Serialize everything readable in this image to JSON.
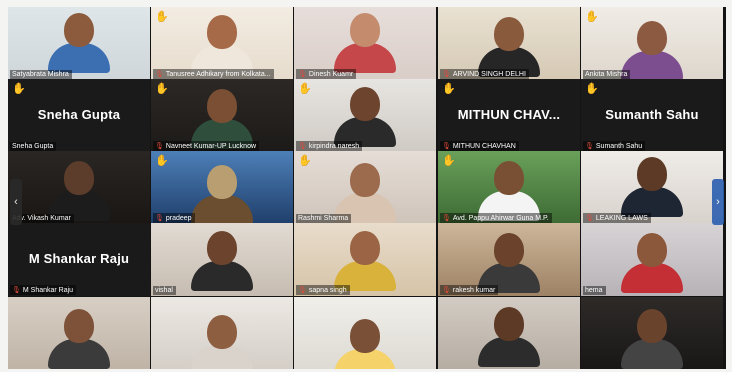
{
  "meeting": {
    "mic_glyph": "🎙",
    "hand_glyph": "✋",
    "tiles": [
      {
        "caption": "Satyabrata Mishra",
        "big_name": "",
        "hand": false,
        "mic_muted": false,
        "video": "man-blue"
      },
      {
        "caption": "Tanusree Adhikary from Kolkata...",
        "big_name": "",
        "hand": true,
        "mic_muted": true,
        "video": "woman-cream"
      },
      {
        "caption": "Dinesh Kuamr",
        "big_name": "",
        "hand": false,
        "mic_muted": true,
        "video": "woman-red"
      },
      {
        "caption": "ARVIND SINGH DELHI",
        "big_name": "",
        "hand": false,
        "mic_muted": true,
        "video": "man-cap"
      },
      {
        "caption": "Ankita Mishra",
        "big_name": "",
        "hand": true,
        "mic_muted": false,
        "video": "woman-purple"
      },
      {
        "caption": "Sneha Gupta",
        "big_name": "Sneha Gupta",
        "hand": true,
        "mic_muted": false,
        "video": "none"
      },
      {
        "caption": "Navneet Kumar-UP Lucknow",
        "big_name": "",
        "hand": true,
        "mic_muted": true,
        "video": "man-dark"
      },
      {
        "caption": "kirpindra naresh",
        "big_name": "",
        "hand": true,
        "mic_muted": true,
        "video": "man-headset"
      },
      {
        "caption": "MITHUN CHAVHAN",
        "big_name": "MITHUN CHAV...",
        "hand": true,
        "mic_muted": true,
        "video": "none"
      },
      {
        "caption": "Sumanth Sahu",
        "big_name": "Sumanth Sahu",
        "hand": true,
        "mic_muted": true,
        "video": "none"
      },
      {
        "caption": "Adv. Vikash Kumar",
        "big_name": "",
        "hand": false,
        "mic_muted": false,
        "video": "man-dim"
      },
      {
        "caption": "pradeep",
        "big_name": "",
        "hand": true,
        "mic_muted": true,
        "video": "temple"
      },
      {
        "caption": "Rashmi Sharma",
        "big_name": "",
        "hand": true,
        "mic_muted": false,
        "video": "woman-glasses"
      },
      {
        "caption": "Avd. Pappu Ahirwar Guna M.P.",
        "big_name": "",
        "hand": true,
        "mic_muted": true,
        "video": "man-outdoor"
      },
      {
        "caption": "LEAKING LAWS",
        "big_name": "",
        "hand": false,
        "mic_muted": true,
        "video": "man-suit"
      },
      {
        "caption": "M Shankar Raju",
        "big_name": "M Shankar Raju",
        "hand": false,
        "mic_muted": true,
        "video": "none"
      },
      {
        "caption": "vishal",
        "big_name": "",
        "hand": false,
        "mic_muted": false,
        "video": "man-headphones"
      },
      {
        "caption": "sapna singh",
        "big_name": "",
        "hand": false,
        "mic_muted": true,
        "video": "woman-yellow"
      },
      {
        "caption": "rakesh kumar",
        "big_name": "",
        "hand": false,
        "mic_muted": true,
        "video": "man-room"
      },
      {
        "caption": "hema",
        "big_name": "",
        "hand": false,
        "mic_muted": false,
        "video": "woman-red2"
      },
      {
        "caption": "",
        "big_name": "",
        "hand": false,
        "mic_muted": false,
        "video": "man-smile"
      },
      {
        "caption": "",
        "big_name": "",
        "hand": false,
        "mic_muted": false,
        "video": "woman-sign"
      },
      {
        "caption": "",
        "big_name": "",
        "hand": false,
        "mic_muted": false,
        "video": "bunny"
      },
      {
        "caption": "",
        "big_name": "",
        "hand": false,
        "mic_muted": false,
        "video": "man-beard"
      },
      {
        "caption": "",
        "big_name": "",
        "hand": false,
        "mic_muted": false,
        "video": "man-phone"
      }
    ],
    "nav": {
      "prev": "‹",
      "next": "›"
    }
  }
}
